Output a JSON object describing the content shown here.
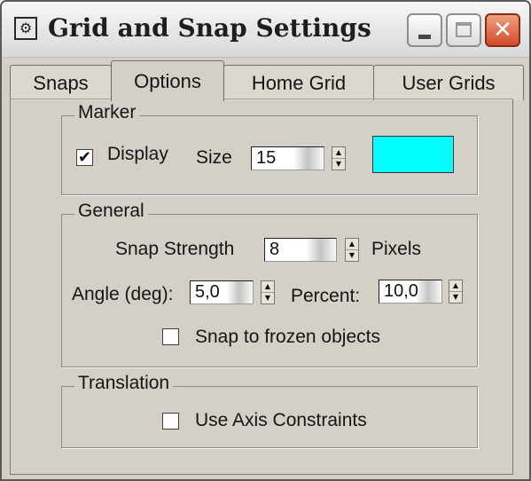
{
  "window": {
    "title": "Grid and Snap Settings",
    "app_icon": "settings-icon",
    "buttons": {
      "minimize": "minimize-icon",
      "maximize": "maximize-icon",
      "close": "close-icon"
    }
  },
  "tabs": [
    {
      "label": "Snaps",
      "active": false
    },
    {
      "label": "Options",
      "active": true
    },
    {
      "label": "Home Grid",
      "active": false
    },
    {
      "label": "User Grids",
      "active": false
    }
  ],
  "marker": {
    "legend": "Marker",
    "display_label": "Display",
    "display_checked": true,
    "size_label": "Size",
    "size_value": "15",
    "color": "#00ffff"
  },
  "general": {
    "legend": "General",
    "snap_strength_label": "Snap Strength",
    "snap_strength_value": "8",
    "pixels_label": "Pixels",
    "angle_label": "Angle (deg):",
    "angle_value": "5,0",
    "percent_label": "Percent:",
    "percent_value": "10,0",
    "snap_frozen_label": "Snap to frozen objects",
    "snap_frozen_checked": false
  },
  "translation": {
    "legend": "Translation",
    "axis_constraints_label": "Use Axis Constraints",
    "axis_constraints_checked": false
  },
  "glyphs": {
    "check": "✔",
    "up": "▲",
    "down": "▼",
    "close": "✕"
  },
  "colors": {
    "dialog_bg": "#d4d0c8",
    "close_button": "#d24a2a"
  }
}
